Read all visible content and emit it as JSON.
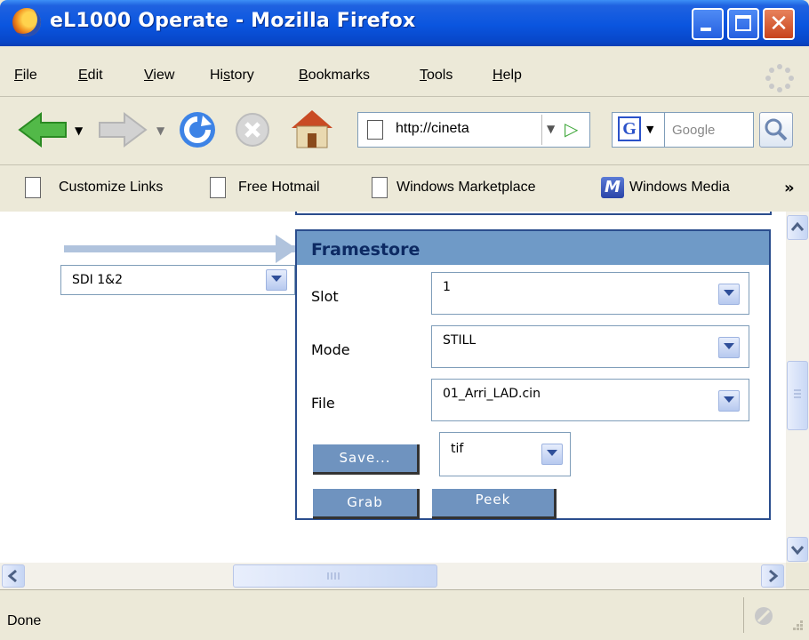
{
  "window": {
    "title": "eL1000 Operate - Mozilla Firefox"
  },
  "menu": {
    "items": [
      {
        "u": "F",
        "rest": "ile"
      },
      {
        "u": "E",
        "rest": "dit"
      },
      {
        "u": "V",
        "rest": "iew"
      },
      {
        "pre": "Hi",
        "u": "s",
        "rest": "tory"
      },
      {
        "u": "B",
        "rest": "ookmarks"
      },
      {
        "u": "T",
        "rest": "ools"
      },
      {
        "u": "H",
        "rest": "elp"
      }
    ]
  },
  "nav": {
    "url": "http://cineta",
    "search_placeholder": "Google"
  },
  "bookmarks": {
    "items": [
      "Customize Links",
      "Free Hotmail",
      "Windows Marketplace",
      "Windows Media"
    ],
    "overflow": "»"
  },
  "content": {
    "source_select": "SDI 1&2",
    "panel_title": "Framestore",
    "slot_label": "Slot",
    "slot_value": "1",
    "mode_label": "Mode",
    "mode_value": "STILL",
    "file_label": "File",
    "file_value": "01_Arri_LAD.cin",
    "save_button": "Save...",
    "format_value": "tif",
    "grab_button": "Grab",
    "peek_button": "Peek"
  },
  "status": {
    "text": "Done"
  },
  "colors": {
    "titlebar": "#0a55df",
    "panel_header": "#6f9ac7",
    "panel_border": "#2a4d8d",
    "button": "#6f93bf"
  }
}
